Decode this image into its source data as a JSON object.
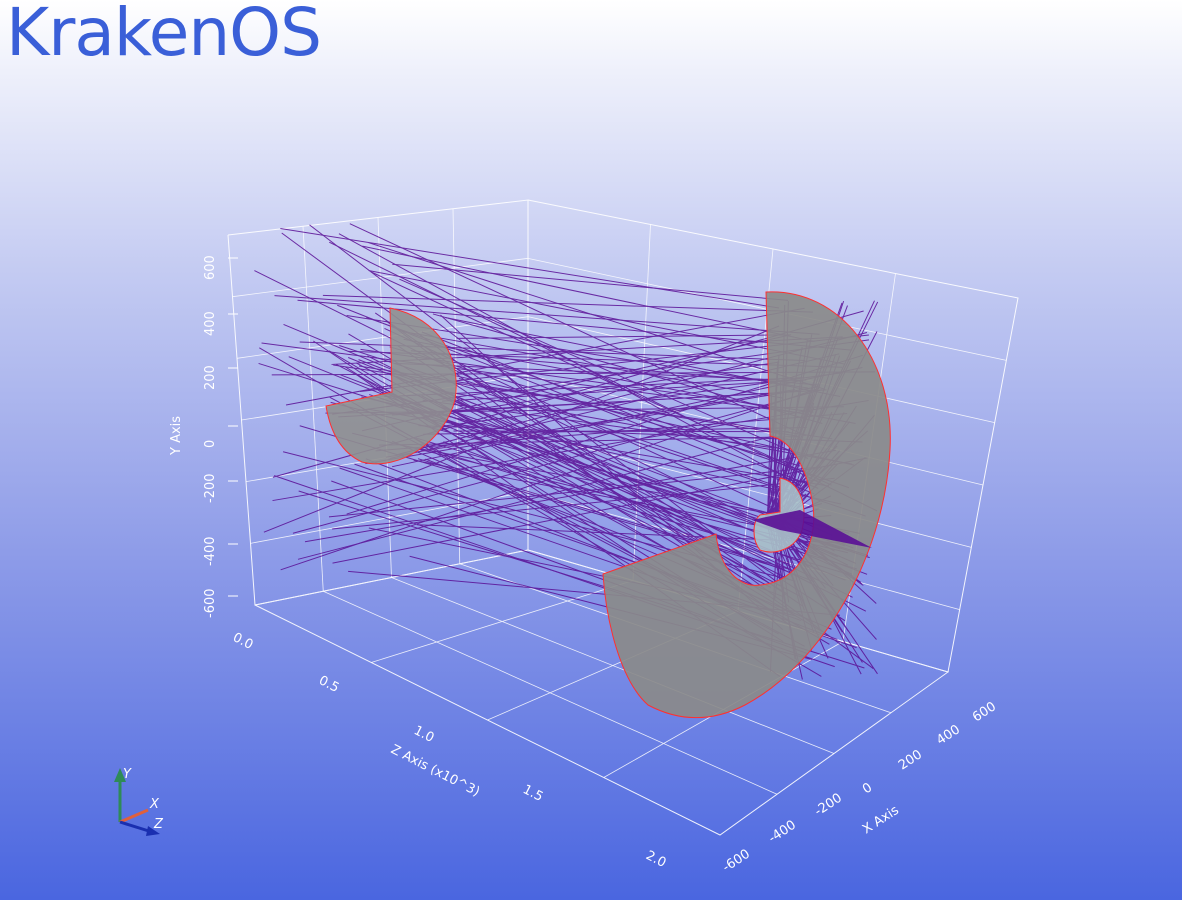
{
  "app": {
    "title": "KrakenOS"
  },
  "plot": {
    "axes": {
      "x": {
        "title": "X Axis",
        "ticks": [
          "-600",
          "-400",
          "-200",
          "0",
          "200",
          "400",
          "600"
        ]
      },
      "y": {
        "title": "Y Axis",
        "ticks": [
          "-600",
          "-400",
          "-200",
          "0",
          "200",
          "400",
          "600"
        ]
      },
      "z": {
        "title": "Z Axis (x10^3)",
        "ticks": [
          "0.0",
          "0.5",
          "1.0",
          "1.5",
          "2.0"
        ]
      }
    },
    "orientation_widget": {
      "y_label": "Y",
      "x_label": "X",
      "z_label": "Z"
    },
    "colors": {
      "rays": "#5a0f96",
      "surface": "#8f8f8f",
      "surface_edge": "#ff3030",
      "grid": "#ffffff",
      "title": "#3a5fd8"
    }
  }
}
